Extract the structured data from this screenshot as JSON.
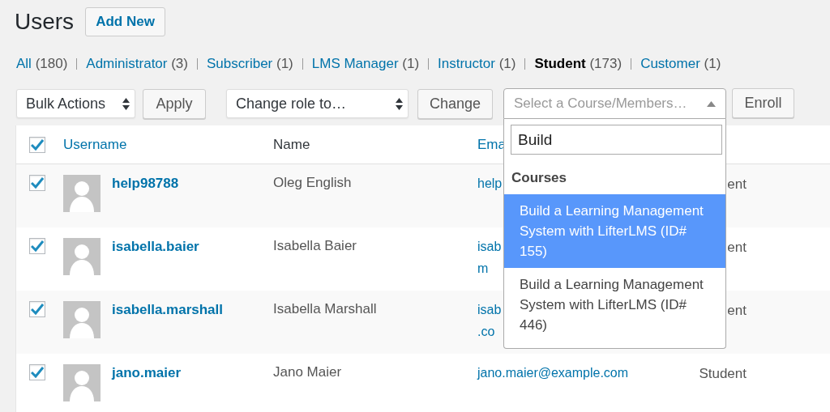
{
  "page_title": "Users",
  "add_new": "Add New",
  "filters": [
    {
      "label": "All",
      "count": "(180)",
      "selected": false
    },
    {
      "label": "Administrator",
      "count": "(3)",
      "selected": false
    },
    {
      "label": "Subscriber",
      "count": "(1)",
      "selected": false
    },
    {
      "label": "LMS Manager",
      "count": "(1)",
      "selected": false
    },
    {
      "label": "Instructor",
      "count": "(1)",
      "selected": false
    },
    {
      "label": "Student",
      "count": "(173)",
      "selected": true
    },
    {
      "label": "Customer",
      "count": "(1)",
      "selected": false
    }
  ],
  "bulk_actions": {
    "value": "Bulk Actions"
  },
  "apply_button": "Apply",
  "change_role": {
    "value": "Change role to…"
  },
  "change_button": "Change",
  "course_select": {
    "placeholder": "Select a Course/Members…",
    "expanded": true,
    "search": "Build",
    "group": "Courses",
    "options": [
      {
        "label": "Build a Learning Management System with LifterLMS (ID# 155)",
        "selected": true
      },
      {
        "label": "Build a Learning Management System with LifterLMS (ID# 446)",
        "selected": false
      }
    ]
  },
  "enroll_button": "Enroll",
  "table": {
    "select_all": true,
    "columns": [
      {
        "label": "Username",
        "kind": "link"
      },
      {
        "label": "Name",
        "kind": "plain"
      },
      {
        "label": "Ema",
        "kind": "link"
      }
    ],
    "rows": [
      {
        "checked": true,
        "username": "help98788",
        "name": "Oleg English",
        "email": [
          "help"
        ],
        "role": "ent"
      },
      {
        "checked": true,
        "username": "isabella.baier",
        "name": "Isabella Baier",
        "email": [
          "isab",
          "m"
        ],
        "role": "ent"
      },
      {
        "checked": true,
        "username": "isabella.marshall",
        "name": "Isabella Marshall",
        "email": [
          "isab",
          ".co"
        ],
        "role": "ent"
      },
      {
        "checked": true,
        "username": "jano.maier",
        "name": "Jano Maier",
        "email": [
          "jano.maier@example.com"
        ],
        "role": "Student"
      }
    ]
  }
}
